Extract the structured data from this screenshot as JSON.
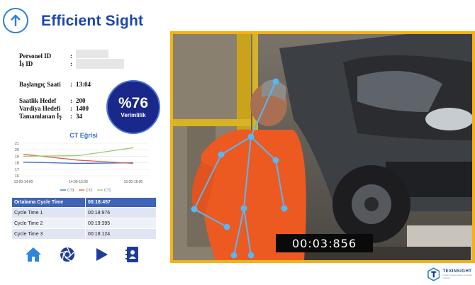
{
  "app": {
    "title": "Efficient Sight"
  },
  "info": {
    "personel_id_label": "Personel ID",
    "is_id_label": "İş ID",
    "baslangic_label": "Başlangıç Saati",
    "baslangic_value": "13:04",
    "saatlik_label": "Saatlik Hedef",
    "saatlik_value": "200",
    "vardiya_label": "Vardiya Hedefi",
    "vardiya_value": "1400",
    "tamamlanan_label": "Tamamlanan İş",
    "tamamlanan_value": "34",
    "colon": ":"
  },
  "efficiency": {
    "value": "%76",
    "label": "Verimlilik"
  },
  "chart_data": {
    "type": "line",
    "title": "CT Eğrisi",
    "categories": [
      "13:00-14:00",
      "14:00-15:00",
      "15:00-16:00"
    ],
    "ylim": [
      16,
      21
    ],
    "yticks": [
      16,
      17,
      18,
      19,
      20,
      21
    ],
    "grid": true,
    "legend": "bottom",
    "series": [
      {
        "name": "CT3",
        "color": "#3b6fc8",
        "values": [
          18.1,
          17.9,
          18.0
        ]
      },
      {
        "name": "CT2",
        "color": "#e05a4a",
        "values": [
          19.3,
          18.4,
          17.9
        ]
      },
      {
        "name": "CT1",
        "color": "#9ccc6a",
        "values": [
          19.0,
          19.1,
          20.3
        ]
      }
    ]
  },
  "cycle_table": {
    "header": [
      "Ortalama Cycle Time",
      "00:18:457"
    ],
    "rows": [
      [
        "Cycle Time 1",
        "00:18:976"
      ],
      [
        "Cycle Time 2",
        "00:19:395"
      ],
      [
        "Cycle Time 3",
        "00:18:124"
      ]
    ]
  },
  "nav": [
    "home-icon",
    "camera-shutter-icon",
    "play-icon",
    "contact-card-icon"
  ],
  "video": {
    "timer": "00:03:856"
  },
  "brand": {
    "name": "TEXINSIGHT",
    "tagline": "Digital transformation for textile industry"
  },
  "colors": {
    "accent": "#1b45b3",
    "frame": "#f2b319",
    "circle": "#19288a",
    "table_head": "#3f63b8"
  }
}
